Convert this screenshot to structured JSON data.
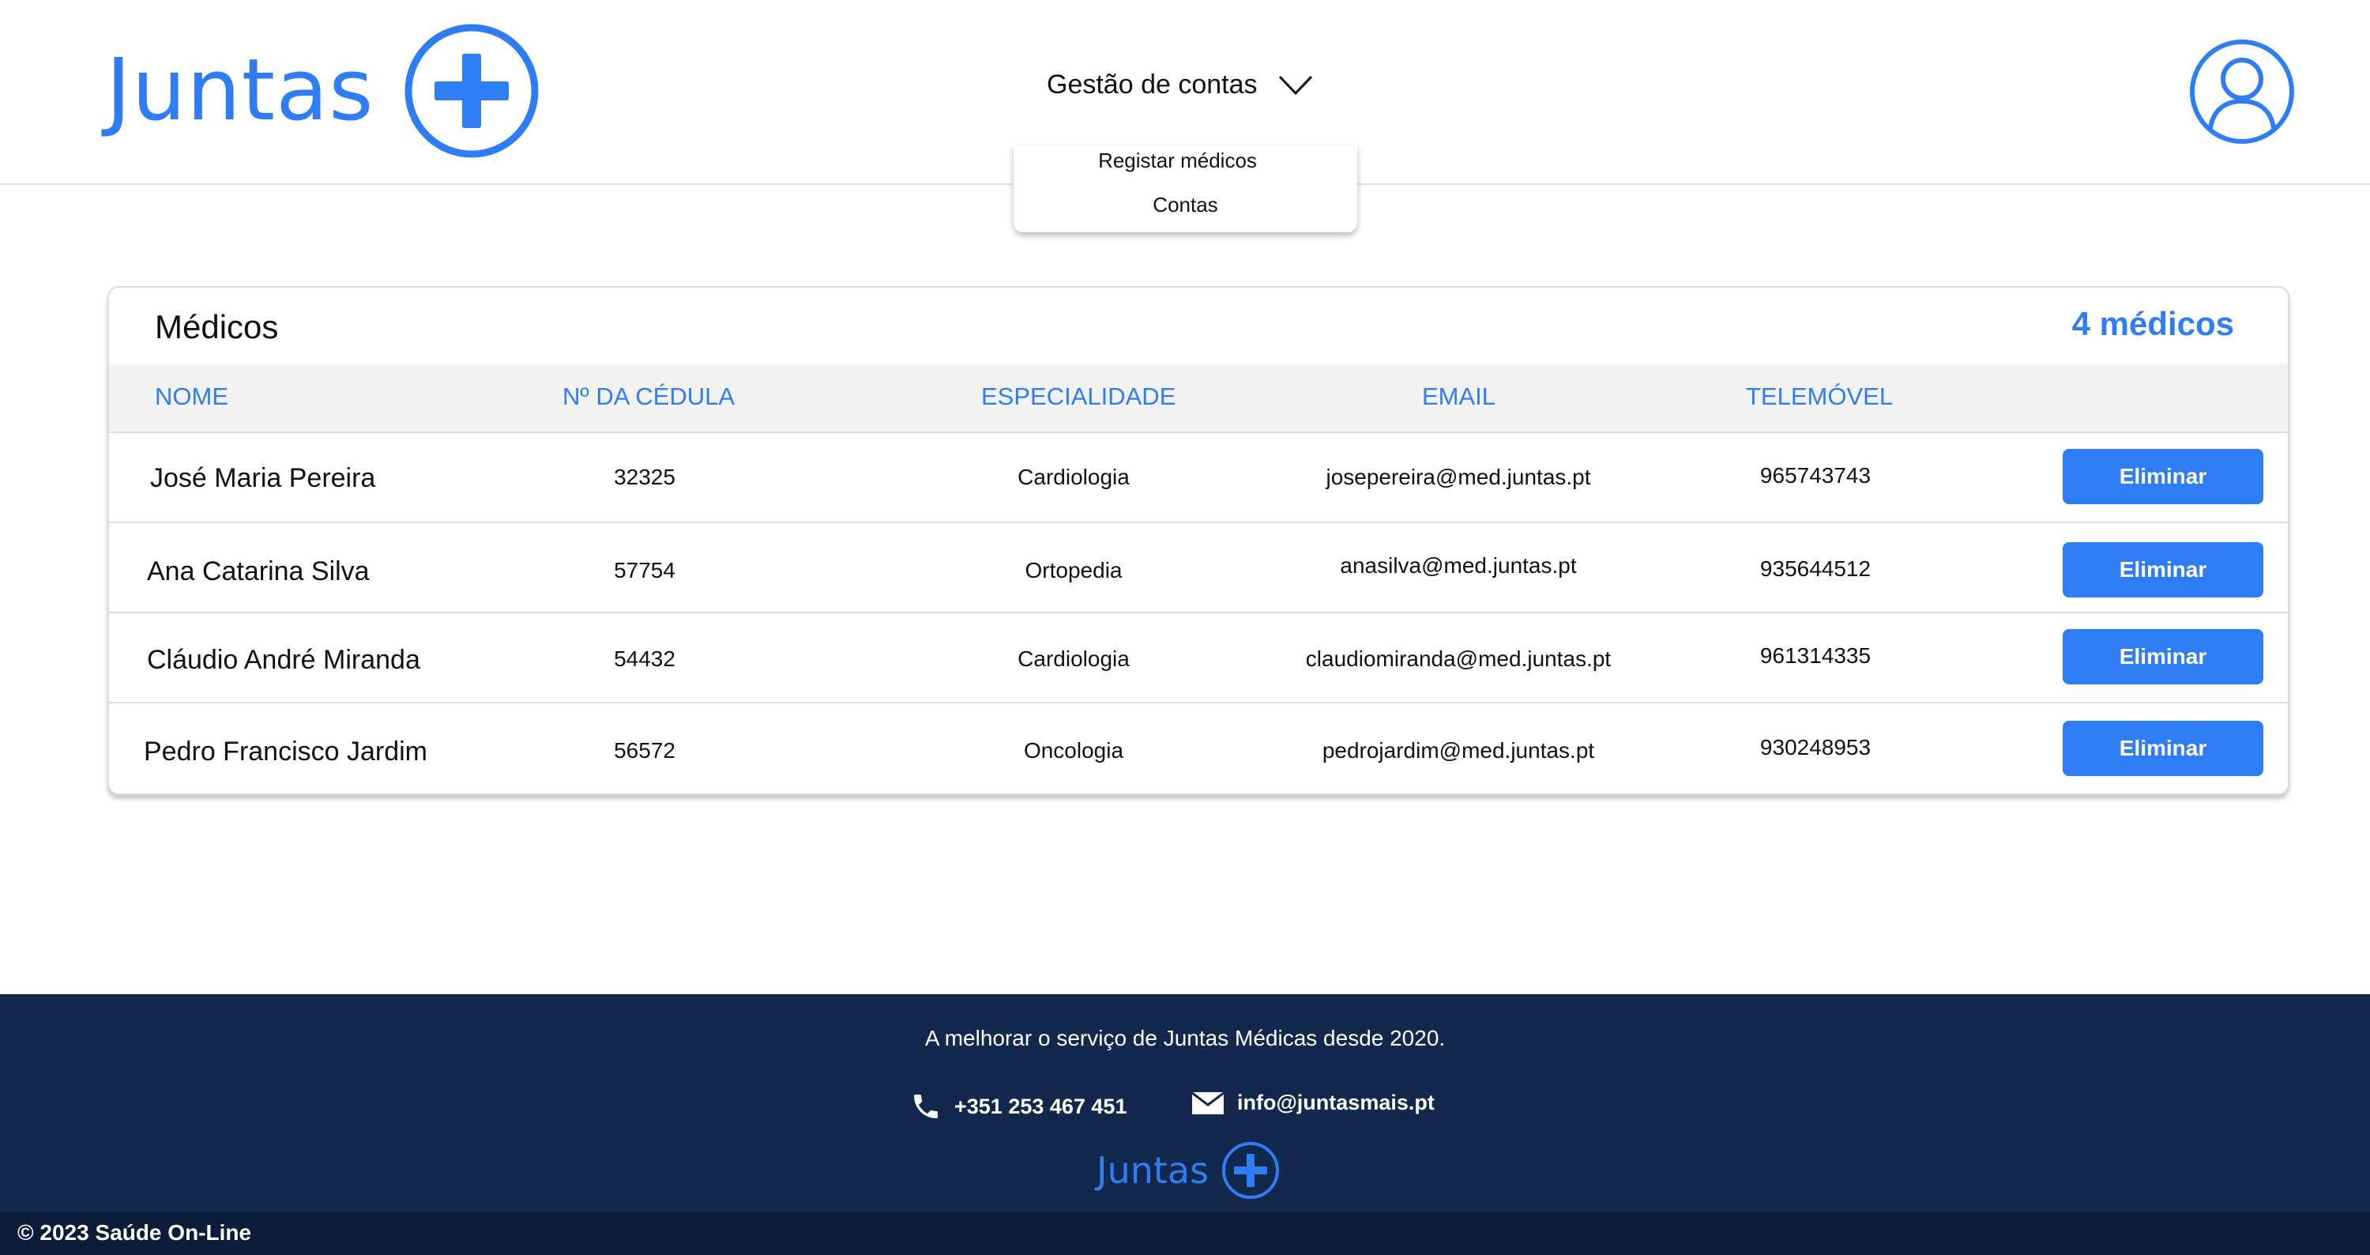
{
  "header": {
    "logo_text": "Juntas",
    "menu_label": "Gestão de contas",
    "dropdown": [
      "Registar médicos",
      "Contas"
    ]
  },
  "table": {
    "title": "Médicos",
    "count": "4 médicos",
    "columns": [
      "NOME",
      "Nº DA CÉDULA",
      "ESPECIALIDADE",
      "EMAIL",
      "TELEMÓVEL"
    ],
    "rows": [
      {
        "name": "José Maria Pereira",
        "cedula": "32325",
        "especialidade": "Cardiologia",
        "email": "josepereira@med.juntas.pt",
        "telemovel": "965743743",
        "action": "Eliminar"
      },
      {
        "name": "Ana Catarina Silva",
        "cedula": "57754",
        "especialidade": "Ortopedia",
        "email": "anasilva@med.juntas.pt",
        "telemovel": "935644512",
        "action": "Eliminar"
      },
      {
        "name": "Cláudio André Miranda",
        "cedula": "54432",
        "especialidade": "Cardiologia",
        "email": "claudiomiranda@med.juntas.pt",
        "telemovel": "961314335",
        "action": "Eliminar"
      },
      {
        "name": "Pedro Francisco Jardim",
        "cedula": "56572",
        "especialidade": "Oncologia",
        "email": "pedrojardim@med.juntas.pt",
        "telemovel": "930248953",
        "action": "Eliminar"
      }
    ]
  },
  "footer": {
    "tagline": "A melhorar o serviço de Juntas Médicas desde 2020.",
    "phone": "+351 253 467 451",
    "email": "info@juntasmais.pt",
    "logo_text": "Juntas",
    "copyright": "© 2023 Saúde On-Line"
  },
  "icons": {
    "logo": "plus-circle-icon",
    "menu": "chevron-down-icon",
    "user": "user-circle-icon",
    "phone": "phone-icon",
    "mail": "mail-icon"
  },
  "colors": {
    "accent": "#2f7df4",
    "footer_bg": "#13284d",
    "bottom_bar_bg": "#0b1c3a"
  }
}
